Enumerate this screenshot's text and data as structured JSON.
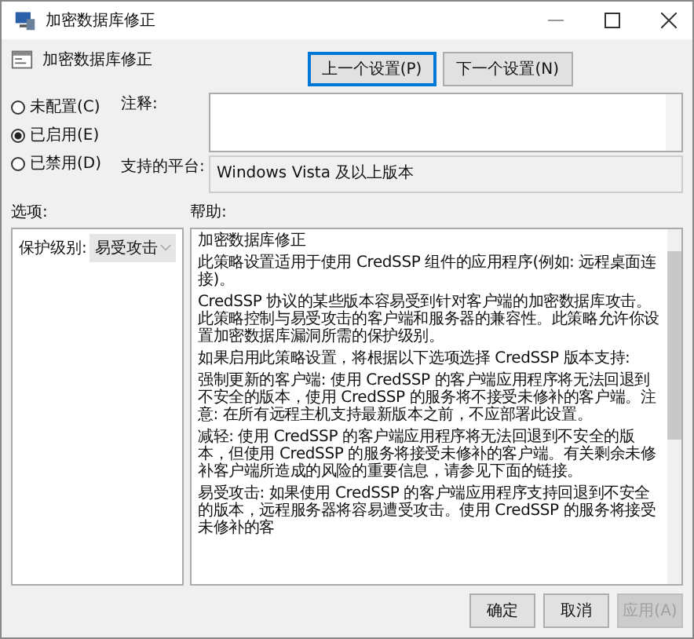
{
  "window": {
    "title": "加密数据库修正"
  },
  "policy": {
    "title": "加密数据库修正"
  },
  "nav_buttons": [
    {
      "label": "上一个设置(P)",
      "focused": true
    },
    {
      "label": "下一个设置(N)",
      "focused": false
    }
  ],
  "state_options": [
    {
      "label": "未配置(C)",
      "selected": false
    },
    {
      "label": "已启用(E)",
      "selected": true
    },
    {
      "label": "已禁用(D)",
      "selected": false
    }
  ],
  "comment": {
    "label": "注释:"
  },
  "platform": {
    "label": "支持的平台:",
    "value": "Windows Vista 及以上版本"
  },
  "options": {
    "label": "选项:",
    "fields": [
      {
        "label": "保护级别:",
        "value": "易受攻击"
      }
    ]
  },
  "help": {
    "label": "帮助:",
    "paragraphs": [
      "加密数据库修正",
      "此策略设置适用于使用 CredSSP 组件的应用程序(例如: 远程桌面连接)。",
      "CredSSP 协议的某些版本容易受到针对客户端的加密数据库攻击。此策略控制与易受攻击的客户端和服务器的兼容性。此策略允许你设置加密数据库漏洞所需的保护级别。",
      "如果启用此策略设置，将根据以下选项选择 CredSSP 版本支持:",
      "强制更新的客户端: 使用 CredSSP 的客户端应用程序将无法回退到不安全的版本，使用 CredSSP 的服务将不接受未修补的客户端。注意: 在所有远程主机支持最新版本之前，不应部署此设置。",
      "减轻: 使用 CredSSP 的客户端应用程序将无法回退到不安全的版本，但使用 CredSSP 的服务将接受未修补的客户端。有关剩余未修补客户端所造成的风险的重要信息，请参见下面的链接。",
      "易受攻击: 如果使用 CredSSP 的客户端应用程序支持回退到不安全的版本，远程服务器将容易遭受攻击。使用 CredSSP 的服务将接受未修补的客"
    ]
  },
  "buttons": [
    {
      "label": "确定",
      "disabled": false
    },
    {
      "label": "取消",
      "disabled": false
    },
    {
      "label": "应用(A)",
      "disabled": true
    }
  ]
}
